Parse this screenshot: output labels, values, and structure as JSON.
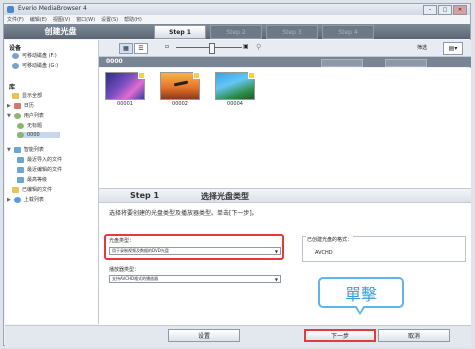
{
  "window": {
    "title": "Everio MediaBrowser 4",
    "menu": [
      "文件(F)",
      "编辑(E)",
      "视图(V)",
      "窗口(W)",
      "设置(S)",
      "帮助(H)"
    ],
    "controls": [
      "–",
      "□",
      "✕"
    ]
  },
  "header": {
    "mode_title": "创建光盘",
    "steps": [
      "Step 1",
      "Step 2",
      "Step 3",
      "Step 4"
    ]
  },
  "toolbar": {
    "filter_label": "筛选",
    "sort_label": "▤▾",
    "zoom_level": 0.55
  },
  "sidebar": {
    "devices_heading": "设备",
    "devices": [
      "可移动磁盘 (F:)",
      "可移动磁盘 (G:)"
    ],
    "library_heading": "库",
    "library": [
      "显示全部",
      "日历",
      "用户列表",
      "无标题",
      "0000"
    ],
    "smart": [
      "智能列表",
      "最近导入的文件",
      "最近编辑的文件",
      "最高等级",
      "已编辑的文件",
      "上载列表"
    ]
  },
  "content": {
    "folder_name": "0000",
    "header_buttons": [
      "",
      ""
    ],
    "thumbnails": [
      {
        "caption": "00001"
      },
      {
        "caption": "00002"
      },
      {
        "caption": "00004"
      }
    ]
  },
  "step_panel": {
    "step_label": "Step 1",
    "title": "选择光盘类型",
    "instruction": "选择将要创建的光盘类型及播放器类型。单击[下一步]。",
    "disc_type_label": "光盘类型：",
    "disc_type_value": "用于录制视频及数据的DVD光盘",
    "player_type_label": "播放器类型：",
    "player_type_value": "支持AVCHD格式的播放器",
    "format_label": "已创建光盘的格式：",
    "format_value": "AVCHD"
  },
  "footer": {
    "settings": "设置",
    "next": "下一步",
    "cancel": "取消"
  },
  "callout": {
    "text": "單擊"
  }
}
